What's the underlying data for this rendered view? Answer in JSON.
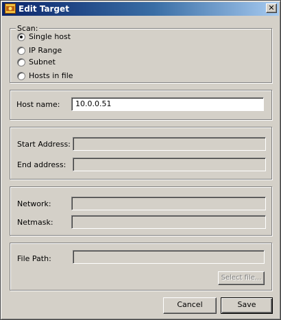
{
  "window": {
    "title": "Edit Target",
    "close_symbol": "✕"
  },
  "scan": {
    "legend": "Scan:",
    "options": [
      {
        "label": "Single host",
        "selected": true
      },
      {
        "label": "IP Range",
        "selected": false
      },
      {
        "label": "Subnet",
        "selected": false
      },
      {
        "label": "Hosts in file",
        "selected": false
      }
    ]
  },
  "host": {
    "label": "Host name:",
    "value": "10.0.0.51"
  },
  "range": {
    "start_label": "Start Address:",
    "start_value": "",
    "end_label": "End address:",
    "end_value": ""
  },
  "subnet": {
    "network_label": "Network:",
    "network_value": "",
    "netmask_label": "Netmask:",
    "netmask_value": ""
  },
  "file": {
    "path_label": "File Path:",
    "path_value": "",
    "select_label": "Select file..."
  },
  "buttons": {
    "cancel": "Cancel",
    "save": "Save"
  }
}
